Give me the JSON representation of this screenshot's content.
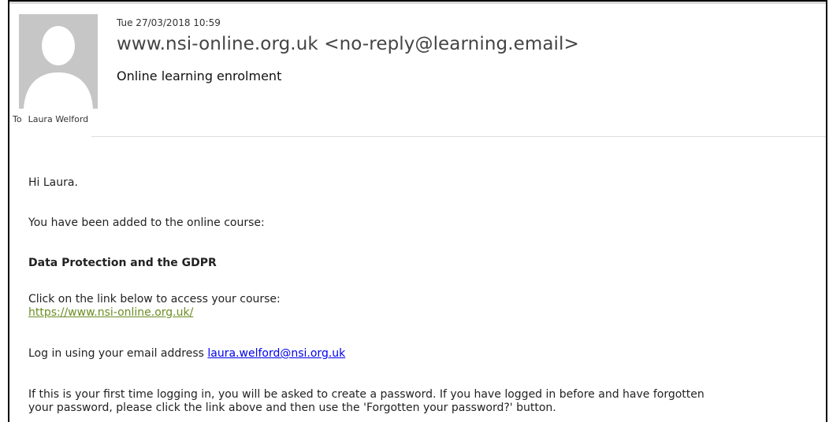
{
  "header": {
    "date": "Tue 27/03/2018 10:59",
    "from": "www.nsi-online.org.uk <no-reply@learning.email>",
    "subject": "Online learning enrolment",
    "to_label": "To",
    "to_name": "Laura Welford"
  },
  "body": {
    "greeting": "Hi Laura.",
    "added_text": "You have been added to the online course:",
    "course_name": "Data Protection and the GDPR",
    "click_text": "Click on the link below to access your course:",
    "course_link": "https://www.nsi-online.org.uk/",
    "login_text": "Log in using your email address",
    "email_link": "laura.welford@nsi.org.uk",
    "first_time_line1": "If this is your first time logging in, you will be asked to create a password. If you have logged in before and have forgotten",
    "first_time_line2": "your password, please click the link above and then use the 'Forgotten your password?' button."
  },
  "icons": {
    "avatar": "person-silhouette-icon"
  },
  "colors": {
    "avatar_bg": "#c6c6c6",
    "avatar_fg": "#ffffff",
    "course_link": "#6b8e23",
    "email_link": "#0000ee"
  }
}
